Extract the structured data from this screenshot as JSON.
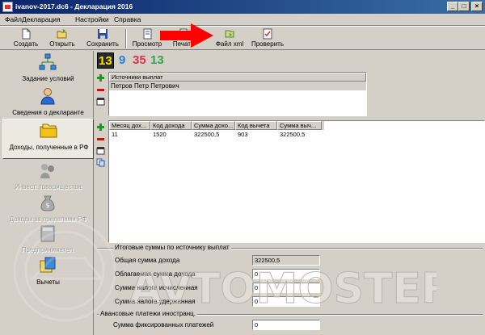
{
  "window": {
    "title": "ivanov-2017.dc6 - Декларация 2016"
  },
  "menu": {
    "items": [
      "Файл",
      "Декларация",
      "Настройки",
      "Справка"
    ]
  },
  "toolbar": {
    "create": "Создать",
    "open": "Открыть",
    "save": "Сохранить",
    "preview": "Просмотр",
    "print": "Печать",
    "xml": "Файл xml",
    "check": "Проверить"
  },
  "sidebar": {
    "items": [
      {
        "label": "Задание условий"
      },
      {
        "label": "Сведения о декларанте"
      },
      {
        "label": "Доходы, полученные в РФ"
      },
      {
        "label": "Инвест. товарищества"
      },
      {
        "label": "Доходы за пределами РФ"
      },
      {
        "label": "Предпринимател."
      },
      {
        "label": "Вычеты"
      }
    ]
  },
  "rate_tabs": [
    "13",
    "9",
    "35",
    "13"
  ],
  "colors": {
    "rate1": "#f5e600",
    "rate2": "#2a7fd4",
    "rate3": "#e0304a",
    "rate4": "#2aa84a"
  },
  "sources": {
    "header": "Источники выплат",
    "rows": [
      "Петров Петр Петрович"
    ]
  },
  "income": {
    "headers": [
      "Месяц дох...",
      "Код дохода",
      "Сумма дохо...",
      "Код вычета",
      "Сумма выч..."
    ],
    "rows": [
      [
        "11",
        "1520",
        "322500,5",
        "903",
        "322500,5"
      ]
    ]
  },
  "totals": {
    "section_title": "Итоговые суммы по источнику выплат",
    "total_income_label": "Общая сумма дохода",
    "total_income_value": "322500,5",
    "taxable_label": "Облагаемая сумма дохода",
    "taxable_value": "0",
    "tax_calc_label": "Сумма налога исчисленная",
    "tax_calc_value": "0",
    "tax_withheld_label": "Сумма налога удержанная",
    "tax_withheld_value": "0",
    "advance_title": "Авансовые платежи иностранц.",
    "fixed_label": "Сумма фиксированных платежей",
    "fixed_value": "0"
  },
  "watermark": "AVTOMOSTER"
}
